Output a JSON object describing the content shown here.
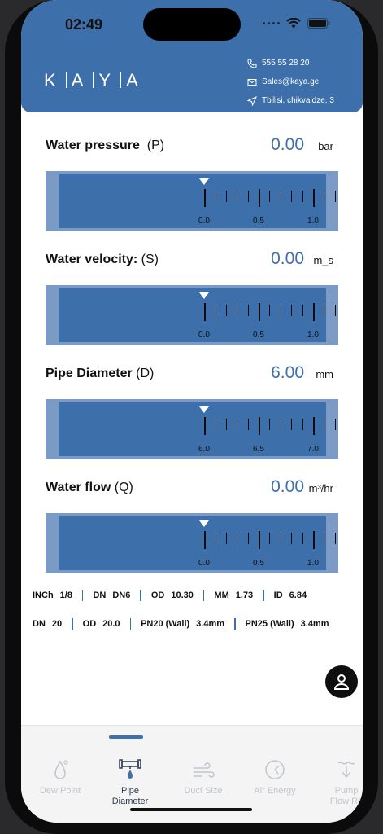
{
  "status": {
    "time": "02:49"
  },
  "brand": {
    "logo": [
      "K",
      "A",
      "Y",
      "A"
    ]
  },
  "contact": {
    "phone": "555 55 28 20",
    "email": "Sales@kaya.ge",
    "address": "Tbilisi, chikvaidze, 3"
  },
  "measures": [
    {
      "label_bold": "Water pressure",
      "label_paren": "(P)",
      "value": "0.00",
      "unit": "bar",
      "ticks": [
        "0.0",
        "0.5",
        "1.0"
      ]
    },
    {
      "label_bold": "Water velocity:",
      "label_paren": "(S)",
      "value": "0.00",
      "unit": "m_s",
      "ticks": [
        "0.0",
        "0.5",
        "1.0"
      ]
    },
    {
      "label_bold": "Pipe Diameter",
      "label_paren": "(D)",
      "value": "6.00",
      "unit": "mm",
      "ticks": [
        "6.0",
        "6.5",
        "7.0"
      ]
    },
    {
      "label_bold": "Water flow",
      "label_paren": "(Q)",
      "value": "0.00",
      "unit": "m³/hr",
      "ticks": [
        "0.0",
        "0.5",
        "1.0"
      ]
    }
  ],
  "specs_row1": [
    {
      "key": "INCh",
      "val": "1/8"
    },
    {
      "key": "DN",
      "val": "DN6"
    },
    {
      "key": "OD",
      "val": "10.30"
    },
    {
      "key": "MM",
      "val": "1.73"
    },
    {
      "key": "ID",
      "val": "6.84"
    }
  ],
  "specs_row2": [
    {
      "key": "DN",
      "val": "20"
    },
    {
      "key": "OD",
      "val": "20.0"
    },
    {
      "key": "PN20 (Wall)",
      "val": "3.4mm"
    },
    {
      "key": "PN25 (Wall)",
      "val": "3.4mm"
    }
  ],
  "tabs": [
    {
      "label": "Dew Point",
      "icon": "drop-icon"
    },
    {
      "label": "Pipe\nDiameter",
      "icon": "pipe-icon"
    },
    {
      "label": "Duct Size",
      "icon": "wind-icon"
    },
    {
      "label": "Air Energy",
      "icon": "gauge-icon"
    },
    {
      "label": "Pump\nFlow Ra",
      "icon": "pump-icon"
    }
  ],
  "active_tab": 1,
  "colors": {
    "brand": "#3d6faa",
    "ruler_frame": "#7b9ac5"
  }
}
